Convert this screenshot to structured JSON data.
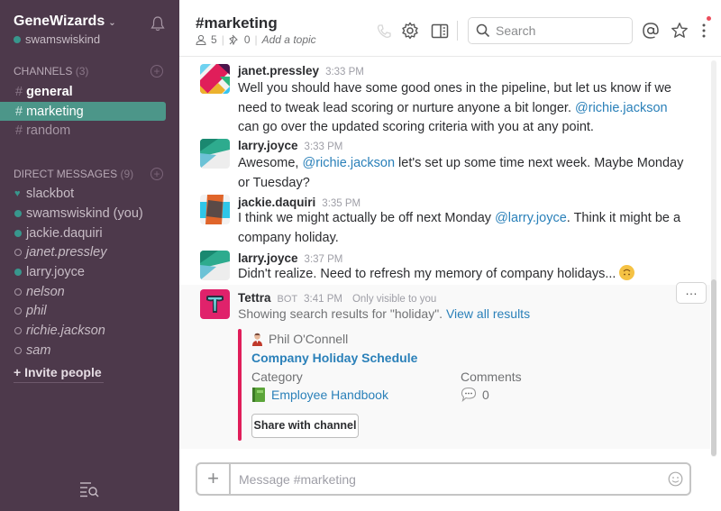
{
  "sidebar": {
    "team_name": "GeneWizards",
    "current_user": "swamswiskind",
    "channels_header": "CHANNELS",
    "channels_count": "(3)",
    "channels": [
      {
        "name": "general",
        "state": "unread"
      },
      {
        "name": "marketing",
        "state": "active"
      },
      {
        "name": "random",
        "state": "muted"
      }
    ],
    "dm_header": "DIRECT MESSAGES",
    "dm_count": "(9)",
    "dms": [
      {
        "name": "slackbot",
        "presence": "bot"
      },
      {
        "name": "swamswiskind (you)",
        "presence": "online"
      },
      {
        "name": "jackie.daquiri",
        "presence": "online"
      },
      {
        "name": "janet.pressley",
        "presence": "away"
      },
      {
        "name": "larry.joyce",
        "presence": "online"
      },
      {
        "name": "nelson",
        "presence": "away"
      },
      {
        "name": "phil",
        "presence": "away"
      },
      {
        "name": "richie.jackson",
        "presence": "away"
      },
      {
        "name": "sam",
        "presence": "away"
      }
    ],
    "invite_label": "+ Invite people"
  },
  "header": {
    "channel_title": "#marketing",
    "member_count": "5",
    "pinned_count": "0",
    "topic_placeholder": "Add a topic",
    "search_placeholder": "Search",
    "icons": [
      "phone-icon",
      "gear-icon",
      "sidebar-toggle-icon",
      "search-icon",
      "mentions-icon",
      "star-icon",
      "more-vertical-icon"
    ]
  },
  "messages": [
    {
      "author": "janet.pressley",
      "time": "3:33 PM",
      "parts": [
        {
          "text": "Well you should have some good ones in the pipeline, but let us know if we need to tweak lead scoring or nurture anyone a bit longer. "
        },
        {
          "text": "@richie.jackson",
          "mention": true
        },
        {
          "text": " can go over the updated scoring criteria with you at any point."
        }
      ]
    },
    {
      "author": "larry.joyce",
      "time": "3:33 PM",
      "parts": [
        {
          "text": "Awesome, "
        },
        {
          "text": "@richie.jackson",
          "mention": true
        },
        {
          "text": " let's set up some time next week. Maybe Monday or Tuesday?"
        }
      ]
    },
    {
      "author": "jackie.daquiri",
      "time": "3:35 PM",
      "parts": [
        {
          "text": "I think we might actually be off next Monday "
        },
        {
          "text": "@larry.joyce",
          "mention": true
        },
        {
          "text": ". Think it might be a company holiday."
        }
      ]
    },
    {
      "author": "larry.joyce",
      "time": "3:37 PM",
      "parts": [
        {
          "text": "Didn't realize. Need to refresh my memory of company holidays..."
        }
      ],
      "emoji": "upside-down-face"
    }
  ],
  "bot_message": {
    "author": "Tettra",
    "bot_label": "BOT",
    "time": "3:41 PM",
    "visibility": "Only visible to you",
    "text": "Showing search results for \"holiday\".",
    "link": "View all results",
    "attachment": {
      "author": "Phil O'Connell",
      "title": "Company Holiday Schedule",
      "category_label": "Category",
      "category_value": "Employee Handbook",
      "comments_label": "Comments",
      "comments_value": "0",
      "share_button": "Share with channel",
      "accent_color": "#e01e5a"
    },
    "more_button": "…"
  },
  "composer": {
    "placeholder": "Message #marketing"
  }
}
